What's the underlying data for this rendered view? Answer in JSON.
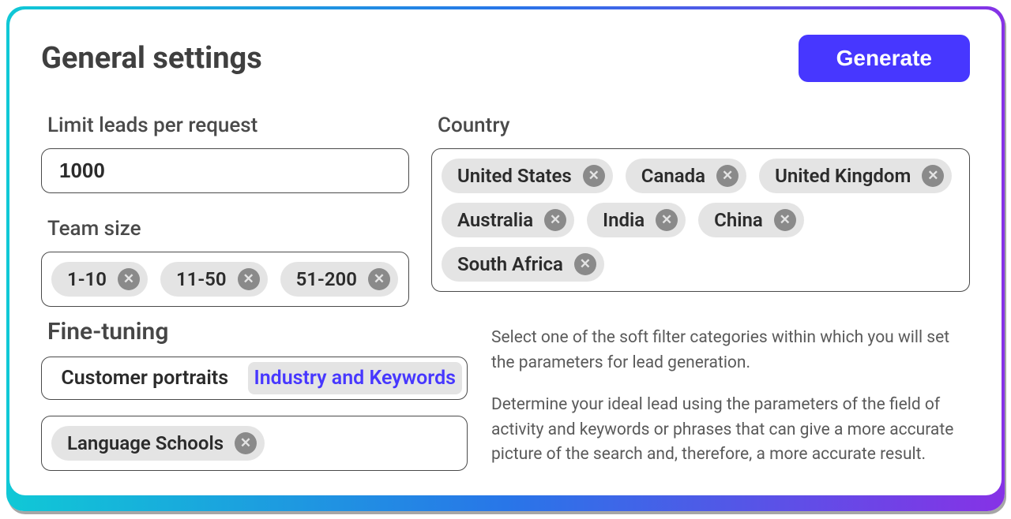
{
  "header": {
    "title": "General settings",
    "generate": "Generate"
  },
  "fields": {
    "limit_label": "Limit leads per request",
    "limit_value": "1000",
    "team_label": "Team size",
    "team_tags": [
      "1-10",
      "11-50",
      "51-200"
    ],
    "country_label": "Country",
    "country_tags": [
      "United States",
      "Canada",
      "United Kingdom",
      "Australia",
      "India",
      "China",
      "South Africa"
    ]
  },
  "fine": {
    "title": "Fine-tuning",
    "tabs": {
      "inactive": "Customer portraits",
      "active": "Industry and Keywords"
    },
    "keyword_tags": [
      "Language Schools"
    ],
    "help_p1": "Select one of the soft filter categories within which you will set the parameters for lead generation.",
    "help_p2": "Determine your ideal lead using the parameters of the field of activity and keywords or phrases that can give a more accurate picture of the search and, therefore, a more accurate result."
  }
}
